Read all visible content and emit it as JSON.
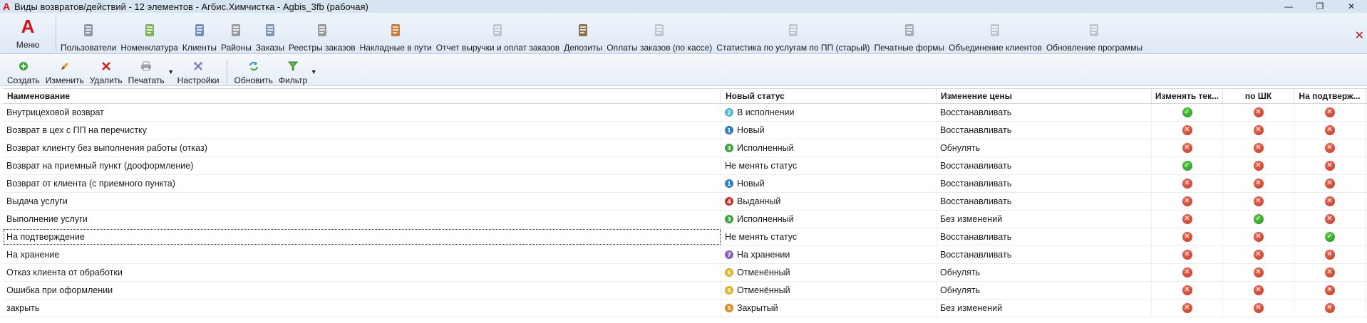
{
  "window": {
    "title": "Виды возвратов/действий - 12 элементов - Агбис.Химчистка - Agbis_3fb (рабочая)",
    "buttons": [
      "—",
      "❐",
      "✕"
    ]
  },
  "mainbar": {
    "menu_label": "Меню",
    "menu_logo": "A",
    "items": [
      {
        "label": "Пользователи",
        "icon": "users-icon",
        "color": "#7a8a9c"
      },
      {
        "label": "Номенклатура",
        "icon": "basket-icon",
        "color": "#6fa83a"
      },
      {
        "label": "Клиенты",
        "icon": "client-icon",
        "color": "#5c7fb0"
      },
      {
        "label": "Районы",
        "icon": "districts-icon",
        "color": "#8c8c8c"
      },
      {
        "label": "Заказы",
        "icon": "orders-icon",
        "color": "#6c86a8"
      },
      {
        "label": "Реестры заказов",
        "icon": "registry-icon",
        "color": "#8a8a8a"
      },
      {
        "label": "Накладные в пути",
        "icon": "truck-icon",
        "color": "#c46a1a"
      },
      {
        "label": "Отчет выручки и оплат заказов",
        "icon": "report-icon",
        "color": "#b8bfc8"
      },
      {
        "label": "Депозиты",
        "icon": "deposit-icon",
        "color": "#7a5a2c"
      },
      {
        "label": "Оплаты заказов (по кассе)",
        "icon": "payments-icon",
        "color": "#b8bfc8"
      },
      {
        "label": "Статистика по услугам по ПП (старый)",
        "icon": "statistics-icon",
        "color": "#b8bfc8"
      },
      {
        "label": "Печатные формы",
        "icon": "printer-icon",
        "color": "#9aa3ad"
      },
      {
        "label": "Объединение клиентов",
        "icon": "merge-icon",
        "color": "#b8bfc8"
      },
      {
        "label": "Обновление программы",
        "icon": "update-icon",
        "color": "#b8bfc8"
      }
    ]
  },
  "toolbar": {
    "items": [
      {
        "label": "Создать",
        "icon": "add-icon"
      },
      {
        "label": "Изменить",
        "icon": "edit-icon"
      },
      {
        "label": "Удалить",
        "icon": "delete-icon"
      },
      {
        "label": "Печатать",
        "icon": "print-icon"
      },
      {
        "label": "Настройки",
        "icon": "settings-icon"
      },
      {
        "label": "Обновить",
        "icon": "refresh-icon"
      },
      {
        "label": "Фильтр",
        "icon": "filter-icon"
      }
    ]
  },
  "grid": {
    "columns": [
      "Наименование",
      "Новый статус",
      "Изменение цены",
      "Изменять тек...",
      "по ШК",
      "На подтверж..."
    ],
    "rows": [
      {
        "name": "Внутрицеховой возврат",
        "status": "В исполнении",
        "status_num": "2",
        "status_color": "#4fb6d8",
        "price": "Восстанавливать",
        "edit": true,
        "shk": false,
        "confirm": false
      },
      {
        "name": "Возврат в цех с ПП на перечистку",
        "status": "Новый",
        "status_num": "1",
        "status_color": "#2d7fc1",
        "price": "Восстанавливать",
        "edit": false,
        "shk": false,
        "confirm": false
      },
      {
        "name": "Возврат клиенту без выполнения работы (отказ)",
        "status": "Исполненный",
        "status_num": "3",
        "status_color": "#3fa33a",
        "price": "Обнулять",
        "edit": false,
        "shk": false,
        "confirm": false
      },
      {
        "name": "Возврат на приемный пункт (дооформление)",
        "status": "Не менять статус",
        "status_num": "",
        "status_color": "",
        "price": "Восстанавливать",
        "edit": true,
        "shk": false,
        "confirm": false
      },
      {
        "name": "Возврат от клиента (с приемного пункта)",
        "status": "Новый",
        "status_num": "1",
        "status_color": "#2d7fc1",
        "price": "Восстанавливать",
        "edit": false,
        "shk": false,
        "confirm": false
      },
      {
        "name": "Выдача услуги",
        "status": "Выданный",
        "status_num": "4",
        "status_color": "#c8302c",
        "price": "Восстанавливать",
        "edit": false,
        "shk": false,
        "confirm": false
      },
      {
        "name": "Выполнение услуги",
        "status": "Исполненный",
        "status_num": "3",
        "status_color": "#3fa33a",
        "price": "Без изменений",
        "edit": false,
        "shk": true,
        "confirm": false
      },
      {
        "name": "На подтверждение",
        "status": "Не менять статус",
        "status_num": "",
        "status_color": "",
        "price": "Восстанавливать",
        "edit": false,
        "shk": false,
        "confirm": true
      },
      {
        "name": "На хранение",
        "status": "На хранении",
        "status_num": "7",
        "status_color": "#8a5fb5",
        "price": "Восстанавливать",
        "edit": false,
        "shk": false,
        "confirm": false
      },
      {
        "name": "Отказ клиента от обработки",
        "status": "Отменённый",
        "status_num": "6",
        "status_color": "#e0b020",
        "price": "Обнулять",
        "edit": false,
        "shk": false,
        "confirm": false
      },
      {
        "name": "Ошибка при оформлении",
        "status": "Отменённый",
        "status_num": "6",
        "status_color": "#e0b020",
        "price": "Обнулять",
        "edit": false,
        "shk": false,
        "confirm": false
      },
      {
        "name": "закрыть",
        "status": "Закрытый",
        "status_num": "5",
        "status_color": "#e08a20",
        "price": "Без изменений",
        "edit": false,
        "shk": false,
        "confirm": false
      }
    ],
    "focused_row": 7
  },
  "colors": {
    "accent": "#d0141b",
    "yes": "#2e9e2a",
    "no": "#d0402a"
  }
}
